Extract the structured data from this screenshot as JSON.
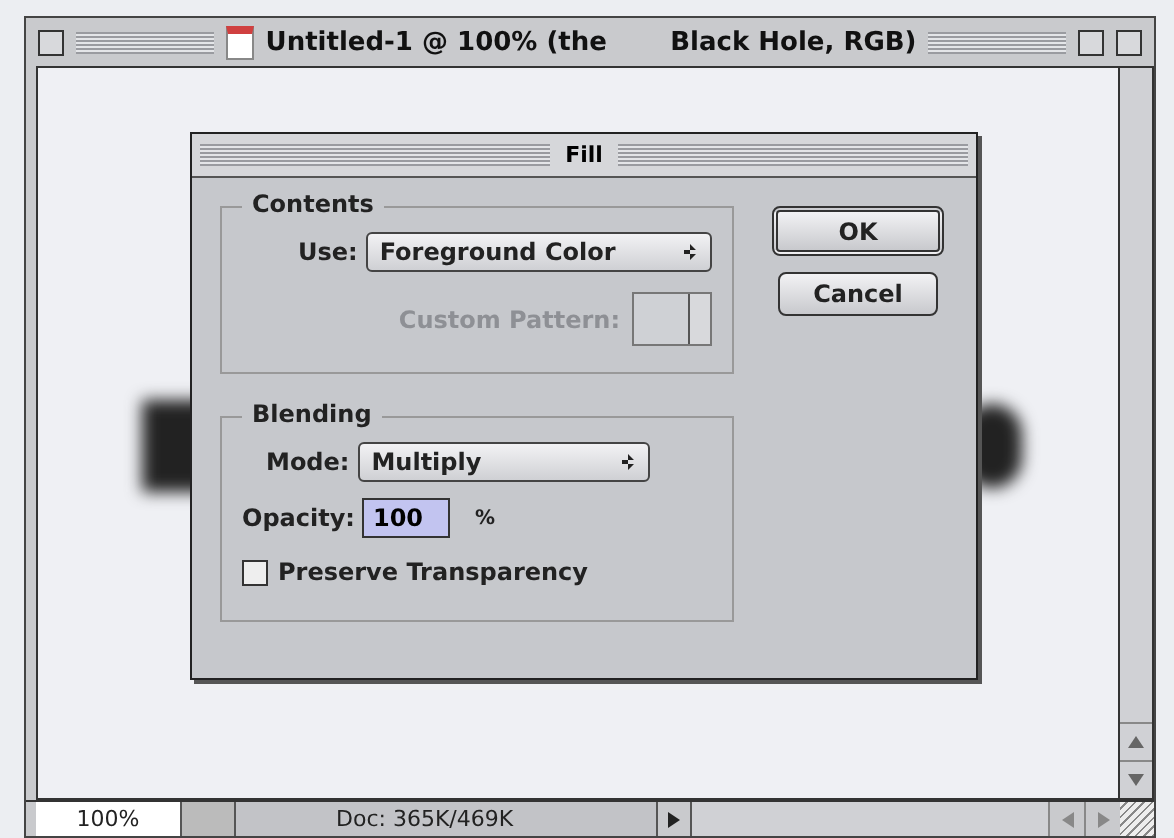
{
  "window": {
    "title": "Untitled-1 @ 100% (the       Black Hole, RGB)"
  },
  "dialog": {
    "title": "Fill",
    "contents": {
      "legend": "Contents",
      "use_label": "Use:",
      "use_value": "Foreground Color",
      "custom_pattern_label": "Custom Pattern:",
      "custom_pattern_disabled": true
    },
    "blending": {
      "legend": "Blending",
      "mode_label": "Mode:",
      "mode_value": "Multiply",
      "opacity_label": "Opacity:",
      "opacity_value": "100",
      "opacity_unit": "%",
      "preserve_transparency": {
        "label": "Preserve Transparency",
        "checked": false
      }
    },
    "buttons": [
      {
        "label": "OK",
        "default": true
      },
      {
        "label": "Cancel",
        "default": false
      }
    ]
  },
  "status_bar": {
    "zoom": "100%",
    "doc_info": "Doc: 365K/469K"
  }
}
